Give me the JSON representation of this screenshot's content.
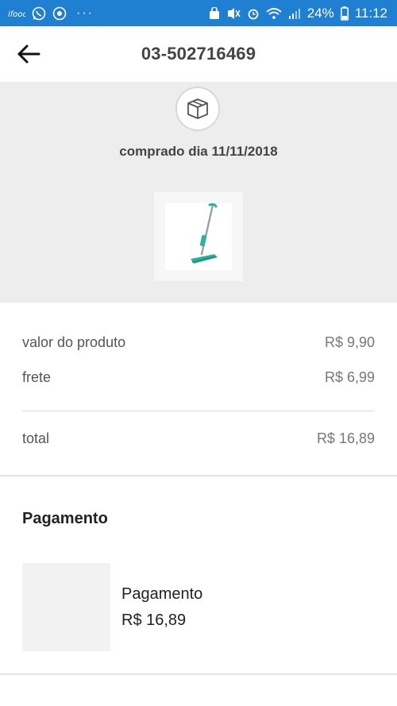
{
  "status_bar": {
    "battery_percent": "24%",
    "time": "11:12",
    "overflow": "···"
  },
  "header": {
    "order_number": "03-502716469"
  },
  "summary": {
    "purchase_date": "comprado dia 11/11/2018"
  },
  "prices": {
    "product_label": "valor do produto",
    "product_value": "R$ 9,90",
    "shipping_label": "frete",
    "shipping_value": "R$ 6,99",
    "total_label": "total",
    "total_value": "R$ 16,89"
  },
  "payment": {
    "heading": "Pagamento",
    "method_label": "Pagamento",
    "amount": "R$ 16,89"
  },
  "colors": {
    "status_bar": "#1f7fd1",
    "summary_bg": "#ededed",
    "mop_accent": "#2db39b"
  },
  "icons": {
    "back": "arrow-left-icon",
    "box": "package-box-icon"
  }
}
